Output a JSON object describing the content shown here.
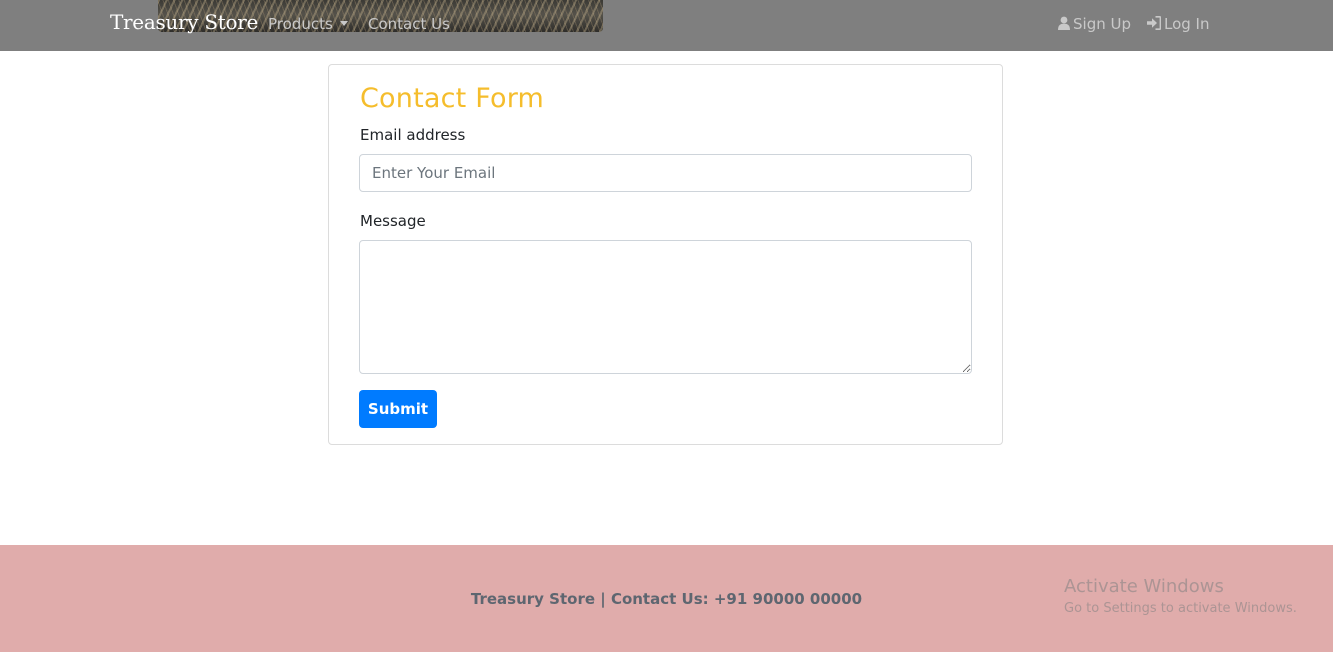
{
  "navbar": {
    "brand": "Treasury Store",
    "products_label": "Products",
    "contact_label": "Contact Us",
    "signup_label": "Sign Up",
    "login_label": "Log In",
    "background": "#7f7f7f"
  },
  "form": {
    "title": "Contact Form",
    "title_color": "#f5bd2c",
    "email_label": "Email address",
    "email_placeholder": "Enter Your Email",
    "email_value": "",
    "message_label": "Message",
    "message_value": "",
    "submit_label": "Submit",
    "submit_color": "#007bff"
  },
  "footer": {
    "text": "Treasury Store | Contact Us: +91 90000 00000",
    "background": "#e0acab"
  },
  "watermark": {
    "title": "Activate Windows",
    "subtitle": "Go to Settings to activate Windows."
  },
  "icons": [
    "user-icon",
    "sign-in-icon",
    "caret-down-icon"
  ]
}
